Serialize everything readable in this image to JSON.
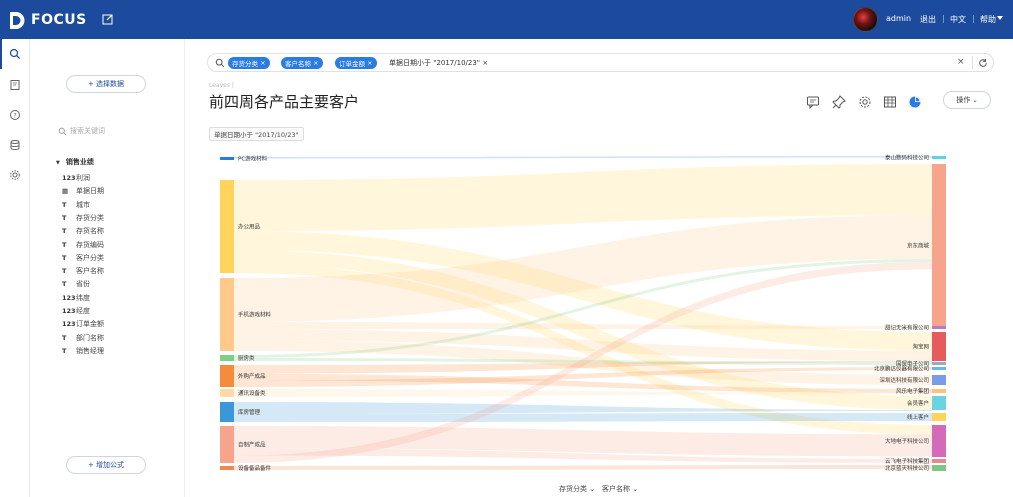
{
  "app": {
    "name": "FOCUS"
  },
  "topbar": {
    "user": "admin",
    "logout": "退出",
    "language": "中文",
    "help": "帮助"
  },
  "left": {
    "select_data_label": "+ 选择数据",
    "search_placeholder": "搜索关键词",
    "root_label": "销售业绩",
    "fields": [
      {
        "type": "123",
        "name": "利润"
      },
      {
        "type": "date",
        "name": "单据日期"
      },
      {
        "type": "text",
        "name": "城市"
      },
      {
        "type": "text",
        "name": "存货分类"
      },
      {
        "type": "text",
        "name": "存货名称"
      },
      {
        "type": "text",
        "name": "存货编码"
      },
      {
        "type": "text",
        "name": "客户分类"
      },
      {
        "type": "text",
        "name": "客户名称"
      },
      {
        "type": "text",
        "name": "省份"
      },
      {
        "type": "123",
        "name": "纬度"
      },
      {
        "type": "123",
        "name": "经度"
      },
      {
        "type": "123",
        "name": "订单金额"
      },
      {
        "type": "text",
        "name": "部门名称"
      },
      {
        "type": "text",
        "name": "销售经理"
      }
    ],
    "add_formula_label": "+ 增加公式"
  },
  "query": {
    "chips": [
      "存货分类",
      "客户名称",
      "订单金额"
    ],
    "text": "单据日期小于 \"2017/10/23\""
  },
  "header": {
    "breadcrumb": "Leaves |",
    "title": "前四周各产品主要客户",
    "operate_label": "操作"
  },
  "filter_tag": "单据日期小于 \"2017/10/23\"",
  "chart_data": {
    "type": "sankey",
    "dimensions": [
      "存货分类",
      "客户名称"
    ],
    "sources": [
      {
        "name": "PC游戏材料",
        "color": "#2a7be2"
      },
      {
        "name": "办公用品",
        "color": "#ffd45c"
      },
      {
        "name": "手机游戏材料",
        "color": "#ffc98a"
      },
      {
        "name": "厨房类",
        "color": "#7ccf86"
      },
      {
        "name": "外购产成品",
        "color": "#f58b3c"
      },
      {
        "name": "通讯设备类",
        "color": "#ffd9a8"
      },
      {
        "name": "库房管理",
        "color": "#3b97d8"
      },
      {
        "name": "自制产成品",
        "color": "#f6a48c"
      },
      {
        "name": "设备备品备件",
        "color": "#f08a4b"
      }
    ],
    "targets": [
      {
        "name": "泰山数码科技公司",
        "color": "#5fd3d8"
      },
      {
        "name": "京东商城",
        "color": "#f6a48c"
      },
      {
        "name": "甜记无米有限公司",
        "color": "#b67ac8"
      },
      {
        "name": "淘宝网",
        "color": "#e65c5c"
      },
      {
        "name": "国贸电子公司",
        "color": "#9aa7c8"
      },
      {
        "name": "北京鹏达仪器有限公司",
        "color": "#6bb5e8"
      },
      {
        "name": "深圳达科技有限公司",
        "color": "#7c9be6"
      },
      {
        "name": "风乐电子集团",
        "color": "#ffc27a"
      },
      {
        "name": "会员客户",
        "color": "#6cd4e0"
      },
      {
        "name": "线上客户",
        "color": "#ffd45c"
      },
      {
        "name": "大地电子科技公司",
        "color": "#d56bb8"
      },
      {
        "name": "云飞电子科技集团",
        "color": "#e88a8a"
      },
      {
        "name": "北京蓝天科技公司",
        "color": "#7cc68a"
      }
    ]
  }
}
